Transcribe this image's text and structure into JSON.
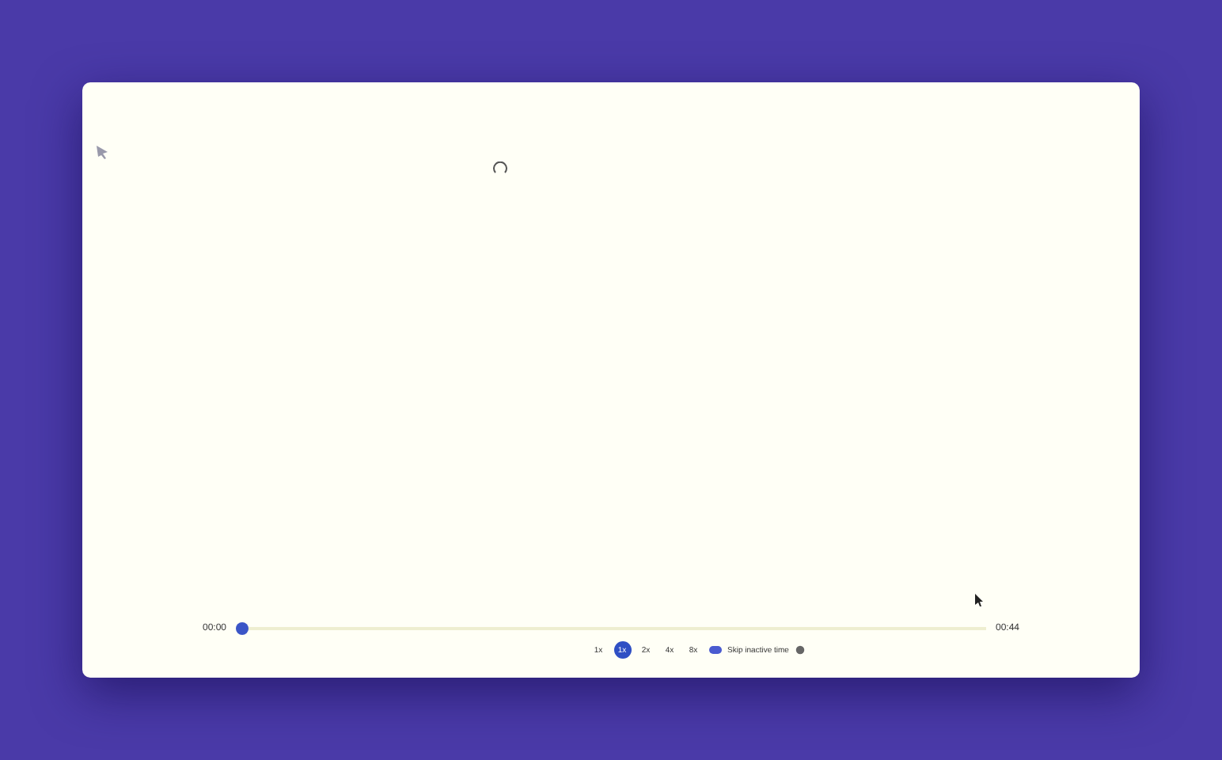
{
  "player": {
    "current_time": "00:00",
    "total_time": "00:44",
    "progress": {
      "level": 0.0
    },
    "speeds": [
      {
        "label": "1x",
        "selected": false
      },
      {
        "label": "1x",
        "selected": true
      },
      {
        "label": "2x",
        "selected": false
      },
      {
        "label": "4x",
        "selected": false
      },
      {
        "label": "8x",
        "selected": false
      }
    ],
    "skip_inactive": {
      "label": "Skip inactive time",
      "on": true
    }
  }
}
